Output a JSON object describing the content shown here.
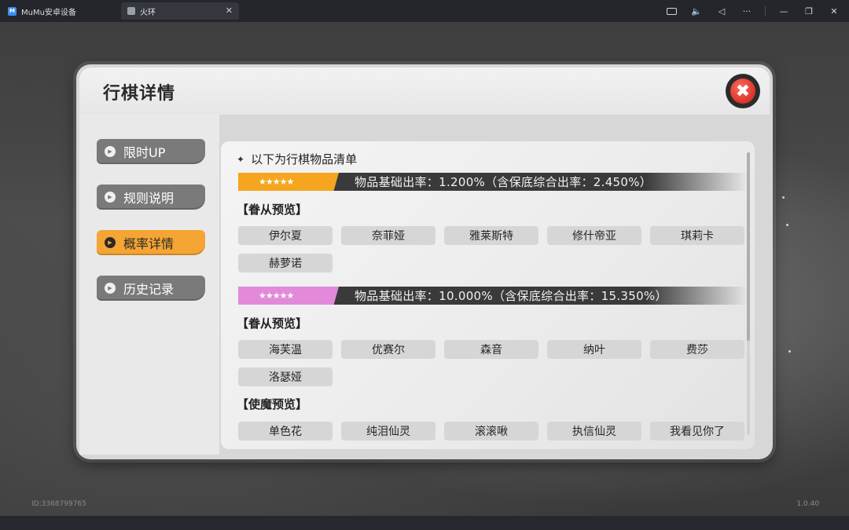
{
  "emulator": {
    "app_name": "MuMu安卓设备",
    "tab_title": "火环",
    "tab_close": "✕",
    "controls": [
      "keyboard-icon",
      "volume-icon",
      "back-icon",
      "more-icon",
      "minimize-icon",
      "restore-icon",
      "close-icon"
    ]
  },
  "game": {
    "uid": "ID:3368799765",
    "version": "1.0.40"
  },
  "dialog": {
    "title": "行棋详情",
    "close_glyph": "✖",
    "nav": [
      {
        "label": "限时UP",
        "active": false
      },
      {
        "label": "规则说明",
        "active": false
      },
      {
        "label": "概率详情",
        "active": true
      },
      {
        "label": "历史记录",
        "active": false
      }
    ],
    "list_heading": "以下为行棋物品清单",
    "tiers": [
      {
        "stars": "★★★★★",
        "badge_color": "#f5a51f",
        "rate_text": "物品基础出率：1.200%（含保底综合出率：2.450%）",
        "groups": [
          {
            "label": "【眷从预览】",
            "items": [
              "伊尔夏",
              "奈菲娅",
              "雅莱斯特",
              "修什帝亚",
              "琪莉卡",
              "赫萝诺"
            ]
          }
        ]
      },
      {
        "stars": "★★★★★",
        "badge_color": "#e28ad9",
        "rate_text": "物品基础出率：10.000%（含保底综合出率：15.350%）",
        "groups": [
          {
            "label": "【眷从预览】",
            "items": [
              "海芙温",
              "优赛尔",
              "森音",
              "纳叶",
              "费莎",
              "洛瑟娅"
            ]
          },
          {
            "label": "【使魔预览】",
            "items": [
              "单色花",
              "纯泪仙灵",
              "滚滚啾",
              "执信仙灵",
              "我看见你了"
            ]
          }
        ]
      }
    ]
  }
}
